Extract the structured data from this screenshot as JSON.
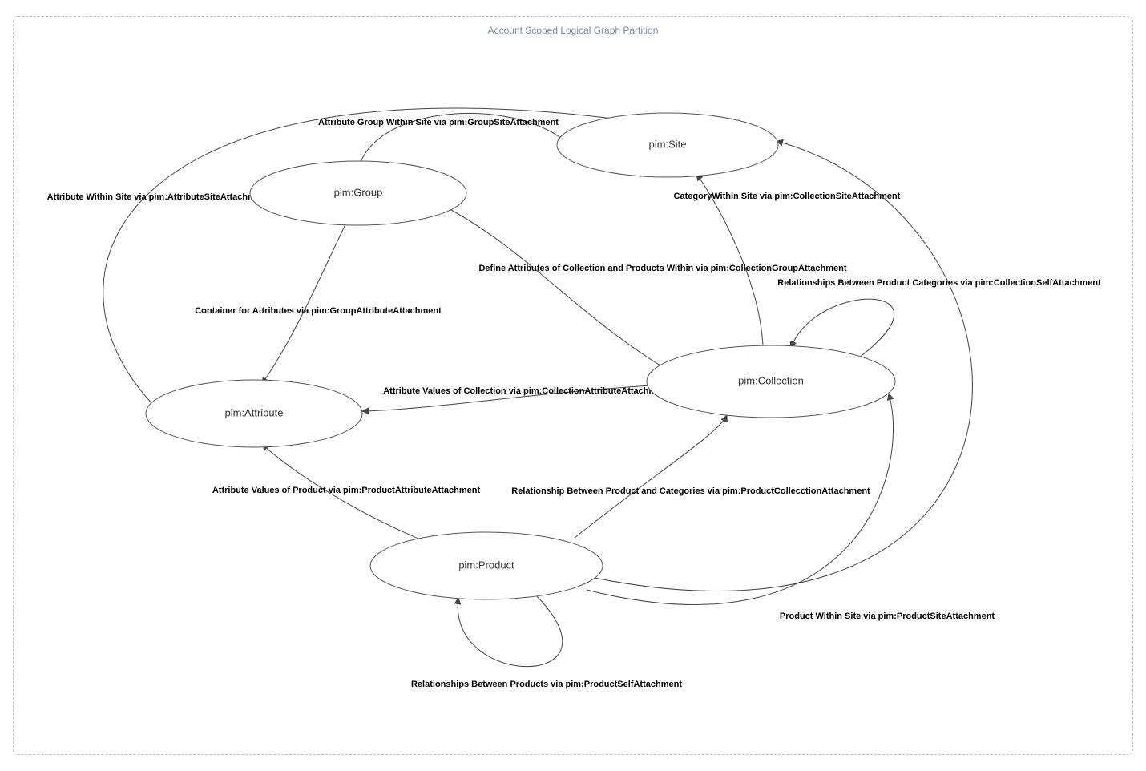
{
  "partition": {
    "title": "Account Scoped Logical Graph Partition"
  },
  "nodes": {
    "site": {
      "label": "pim:Site"
    },
    "group": {
      "label": "pim:Group"
    },
    "attribute": {
      "label": "pim:Attribute"
    },
    "collection": {
      "label": "pim:Collection"
    },
    "product": {
      "label": "pim:Product"
    }
  },
  "edges": {
    "group_site": {
      "label": "Attribute Group Within Site via pim:GroupSiteAttachment"
    },
    "attr_site": {
      "label": "Attribute Within Site via pim:AttributeSiteAttachment"
    },
    "collection_site": {
      "label": "CategoryWithin Site via pim:CollectionSiteAttachment"
    },
    "collection_group": {
      "label": "Define Attributes of Collection and Products Within via pim:CollectionGroupAttachment"
    },
    "group_attribute": {
      "label": "Container for Attributes via pim:GroupAttributeAttachment"
    },
    "collection_self": {
      "label": "Relationships Between Product Categories via pim:CollectionSelfAttachment"
    },
    "collection_attribute": {
      "label": "Attribute Values of Collection via pim:CollectionAttributeAttachment"
    },
    "product_attribute": {
      "label": "Attribute Values of Product via pim:ProductAttributeAttachment"
    },
    "product_collection": {
      "label": "Relationship Between Product and Categories via pim:ProductCollecctionAttachment"
    },
    "product_site": {
      "label": "Product Within Site via pim:ProductSiteAttachment"
    },
    "product_self": {
      "label": "Relationships Between Products via pim:ProductSelfAttachment"
    }
  }
}
